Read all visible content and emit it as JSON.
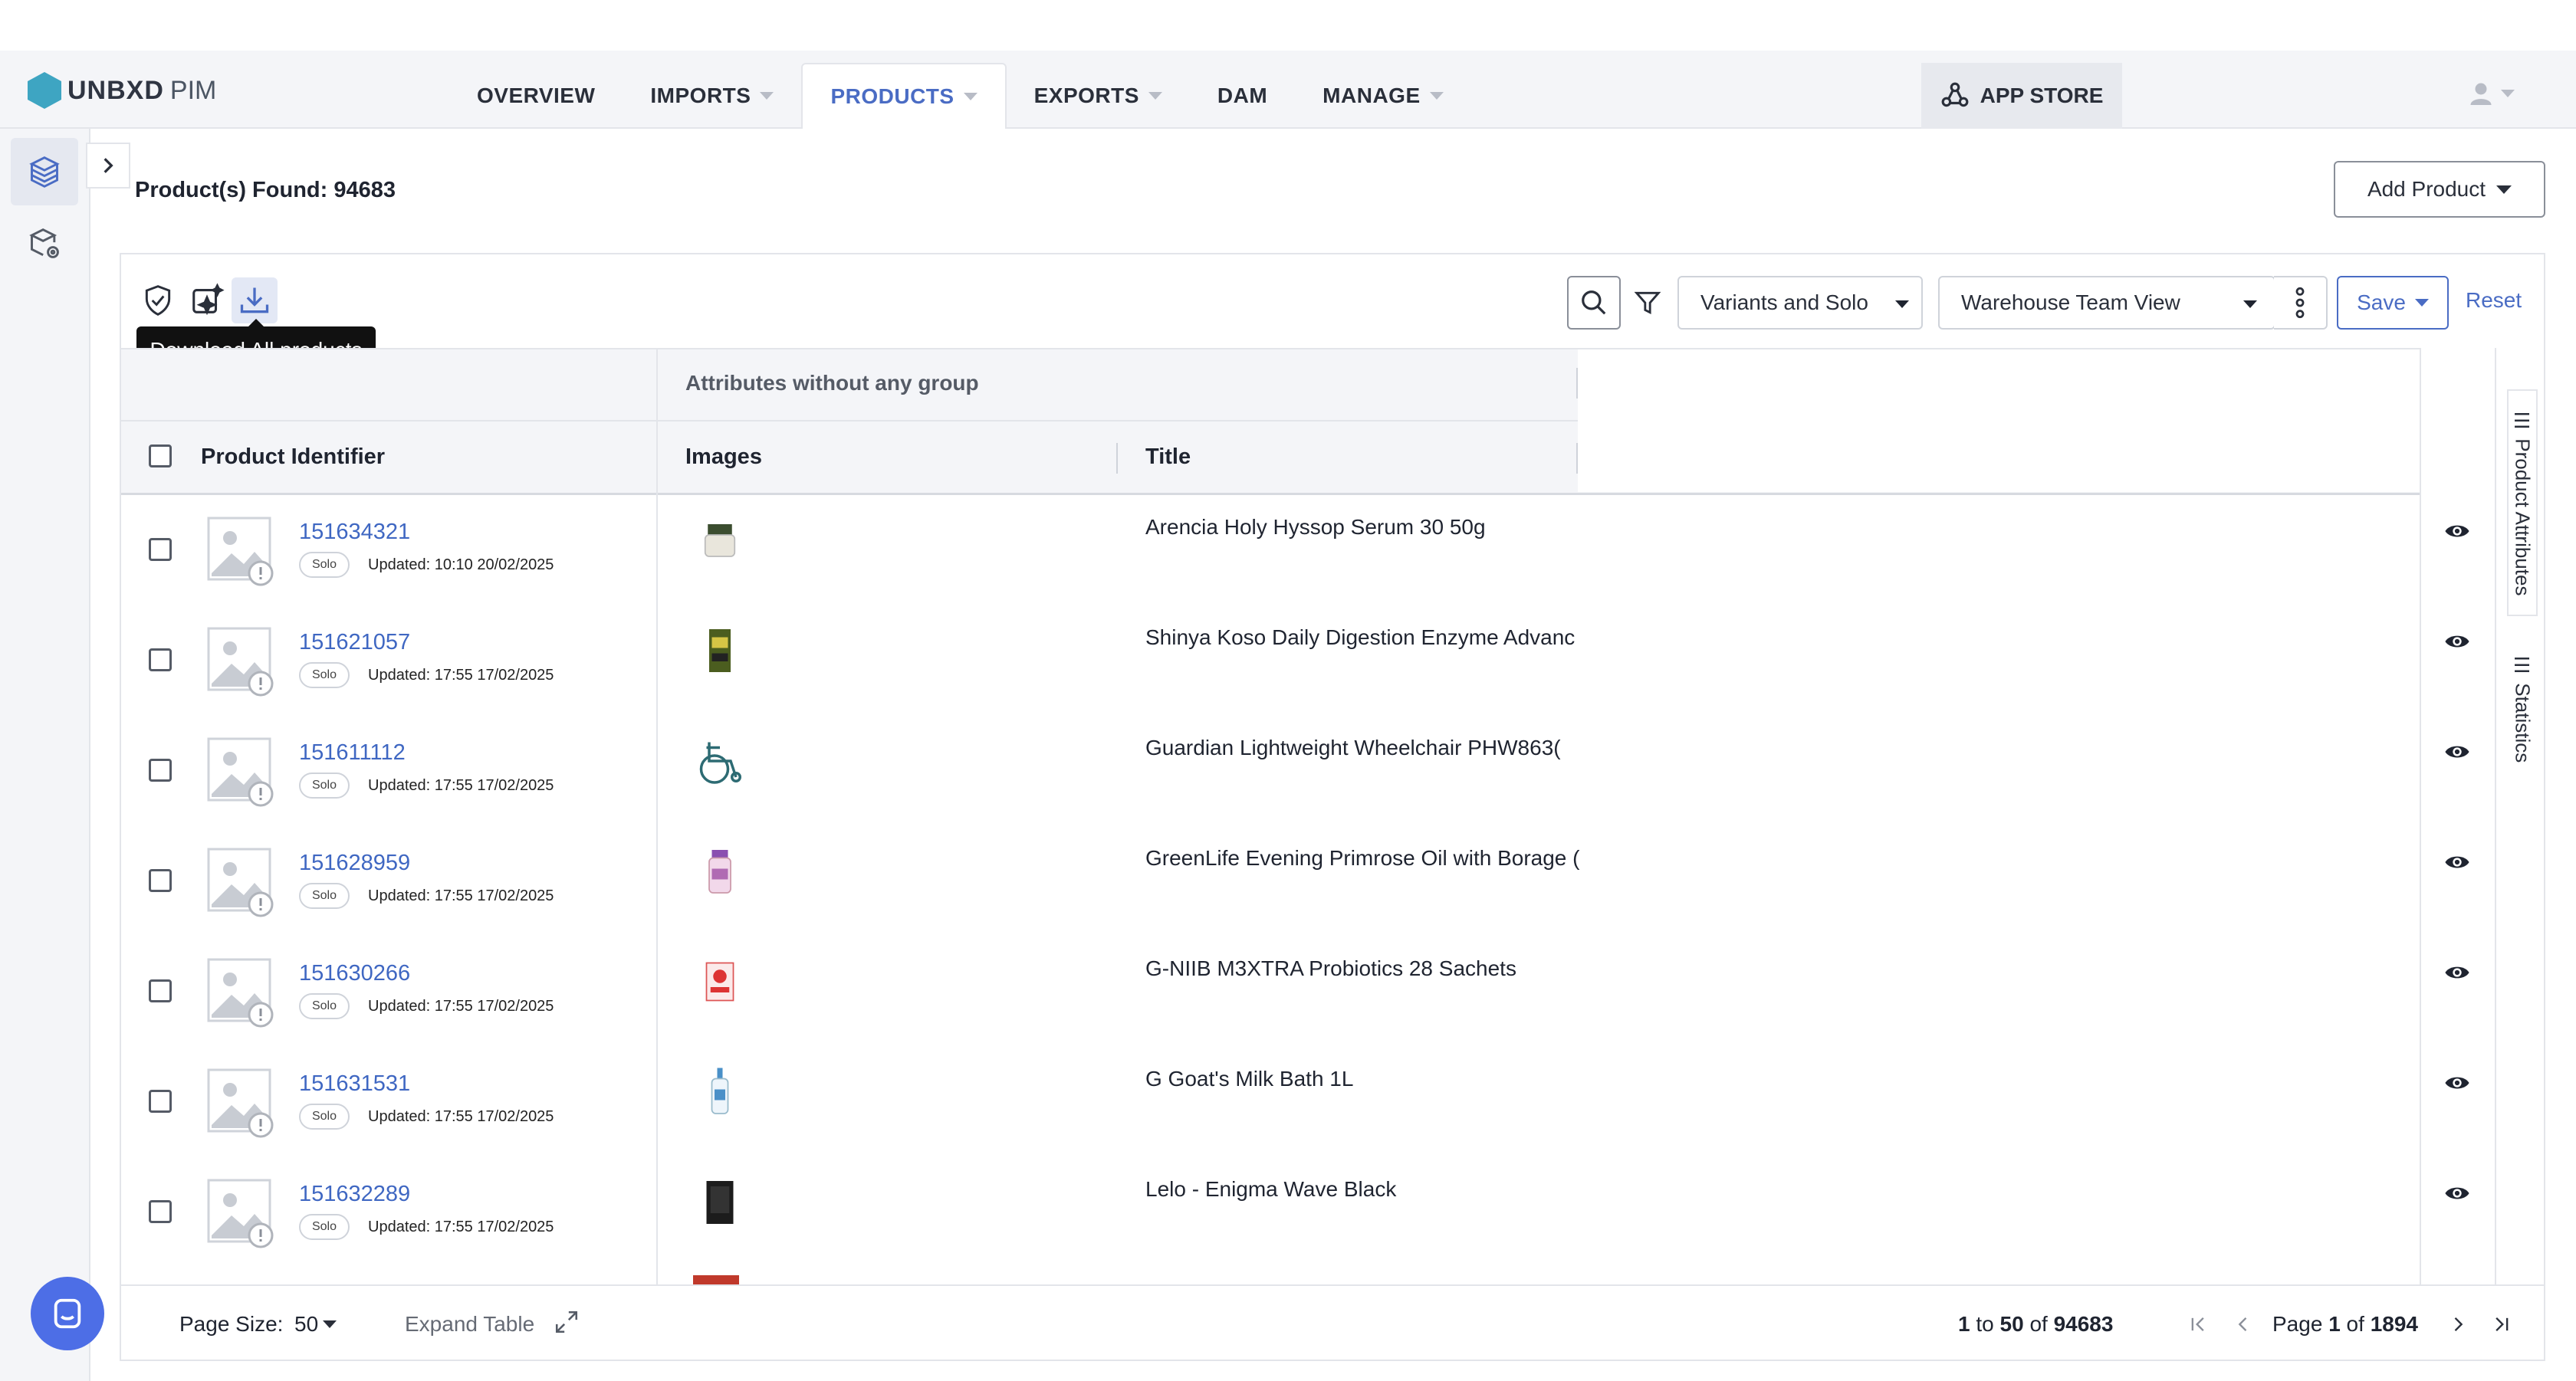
{
  "app": {
    "brand": "UNBXD",
    "brand_suffix": "PIM",
    "brand_color": "#3ea5c2",
    "accent": "#4a6cc4"
  },
  "nav": {
    "items": [
      {
        "label": "OVERVIEW",
        "has_caret": false
      },
      {
        "label": "IMPORTS",
        "has_caret": true
      },
      {
        "label": "PRODUCTS",
        "has_caret": true,
        "active": true
      },
      {
        "label": "EXPORTS",
        "has_caret": true
      },
      {
        "label": "DAM",
        "has_caret": false
      },
      {
        "label": "MANAGE",
        "has_caret": true
      }
    ],
    "app_store": "APP STORE"
  },
  "page": {
    "found_label": "Product(s) Found: 94683",
    "add_product": "Add Product"
  },
  "toolbar": {
    "tooltip": "Download All products",
    "variant_filter": "Variants and Solo",
    "view": "Warehouse Team View",
    "save": "Save",
    "reset": "Reset"
  },
  "table": {
    "group_label": "Attributes without any group",
    "headers": {
      "identifier": "Product Identifier",
      "images": "Images",
      "title": "Title"
    },
    "rows": [
      {
        "id": "151634321",
        "badge": "Solo",
        "updated": "Updated: 10:10 20/02/2025",
        "title": "Arencia Holy Hyssop Serum 30 50g",
        "img": "jar"
      },
      {
        "id": "151621057",
        "badge": "Solo",
        "updated": "Updated: 17:55 17/02/2025",
        "title": "Shinya Koso Daily Digestion Enzyme Advanc",
        "img": "box-green"
      },
      {
        "id": "151611112",
        "badge": "Solo",
        "updated": "Updated: 17:55 17/02/2025",
        "title": "Guardian Lightweight Wheelchair PHW863(",
        "img": "wheelchair"
      },
      {
        "id": "151628959",
        "badge": "Solo",
        "updated": "Updated: 17:55 17/02/2025",
        "title": "GreenLife Evening Primrose Oil with Borage (",
        "img": "bottle-pink"
      },
      {
        "id": "151630266",
        "badge": "Solo",
        "updated": "Updated: 17:55 17/02/2025",
        "title": "G-NIIB M3XTRA Probiotics 28 Sachets",
        "img": "box-red"
      },
      {
        "id": "151631531",
        "badge": "Solo",
        "updated": "Updated: 17:55 17/02/2025",
        "title": "G Goat's Milk Bath 1L",
        "img": "pump-bottle"
      },
      {
        "id": "151632289",
        "badge": "Solo",
        "updated": "Updated: 17:55 17/02/2025",
        "title": "Lelo - Enigma Wave Black",
        "img": "box-black"
      }
    ]
  },
  "side_tabs": {
    "attributes": "Product Attributes",
    "statistics": "Statistics"
  },
  "footer": {
    "page_size_label": "Page Size:",
    "page_size": "50",
    "expand_table": "Expand Table",
    "range_from": "1",
    "range_to_word": "to",
    "range_to": "50",
    "of_word": "of",
    "total": "94683",
    "page_word": "Page",
    "page_current": "1",
    "page_total": "1894"
  }
}
